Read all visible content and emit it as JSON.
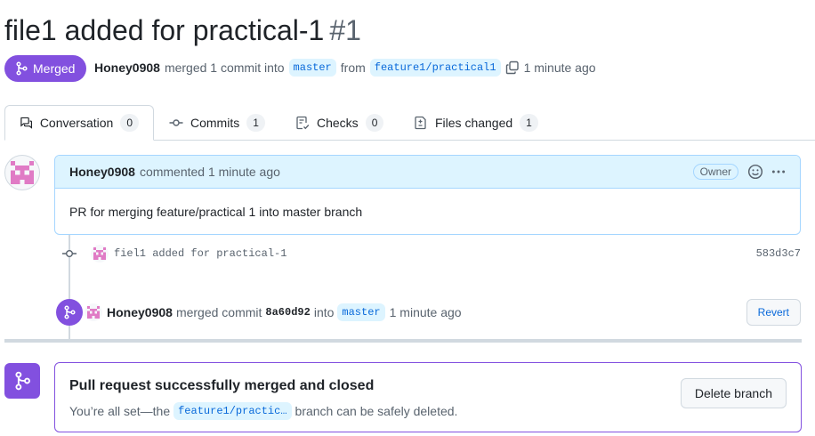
{
  "pr": {
    "title": "file1 added for practical-1",
    "number": "#1",
    "state": "Merged",
    "author": "Honey0908",
    "merged_text": "merged 1 commit into",
    "base_branch": "master",
    "from_text": "from",
    "head_branch": "feature1/practical1",
    "time": "1 minute ago"
  },
  "tabs": [
    {
      "label": "Conversation",
      "count": "0",
      "icon": "comment-discussion-icon"
    },
    {
      "label": "Commits",
      "count": "1",
      "icon": "git-commit-icon"
    },
    {
      "label": "Checks",
      "count": "0",
      "icon": "checklist-icon"
    },
    {
      "label": "Files changed",
      "count": "1",
      "icon": "file-diff-icon"
    }
  ],
  "comment": {
    "author": "Honey0908",
    "action": "commented 1 minute ago",
    "role": "Owner",
    "body": "PR for merging feature/practical 1 into master branch"
  },
  "commit": {
    "message": "fiel1 added for practical-1",
    "sha": "583d3c7"
  },
  "merge_event": {
    "author": "Honey0908",
    "text1": "merged commit",
    "sha": "8a60d92",
    "text2": "into",
    "branch": "master",
    "time": "1 minute ago",
    "revert_label": "Revert"
  },
  "merge_box": {
    "title": "Pull request successfully merged and closed",
    "sub_prefix": "You’re all set—the",
    "branch": "feature1/practic…",
    "sub_suffix": "branch can be safely deleted.",
    "delete_label": "Delete branch"
  },
  "colors": {
    "merged_purple": "#8250df",
    "link_blue": "#0969da",
    "comment_bg": "#ddf4ff",
    "comment_border": "#a5d6ff"
  }
}
